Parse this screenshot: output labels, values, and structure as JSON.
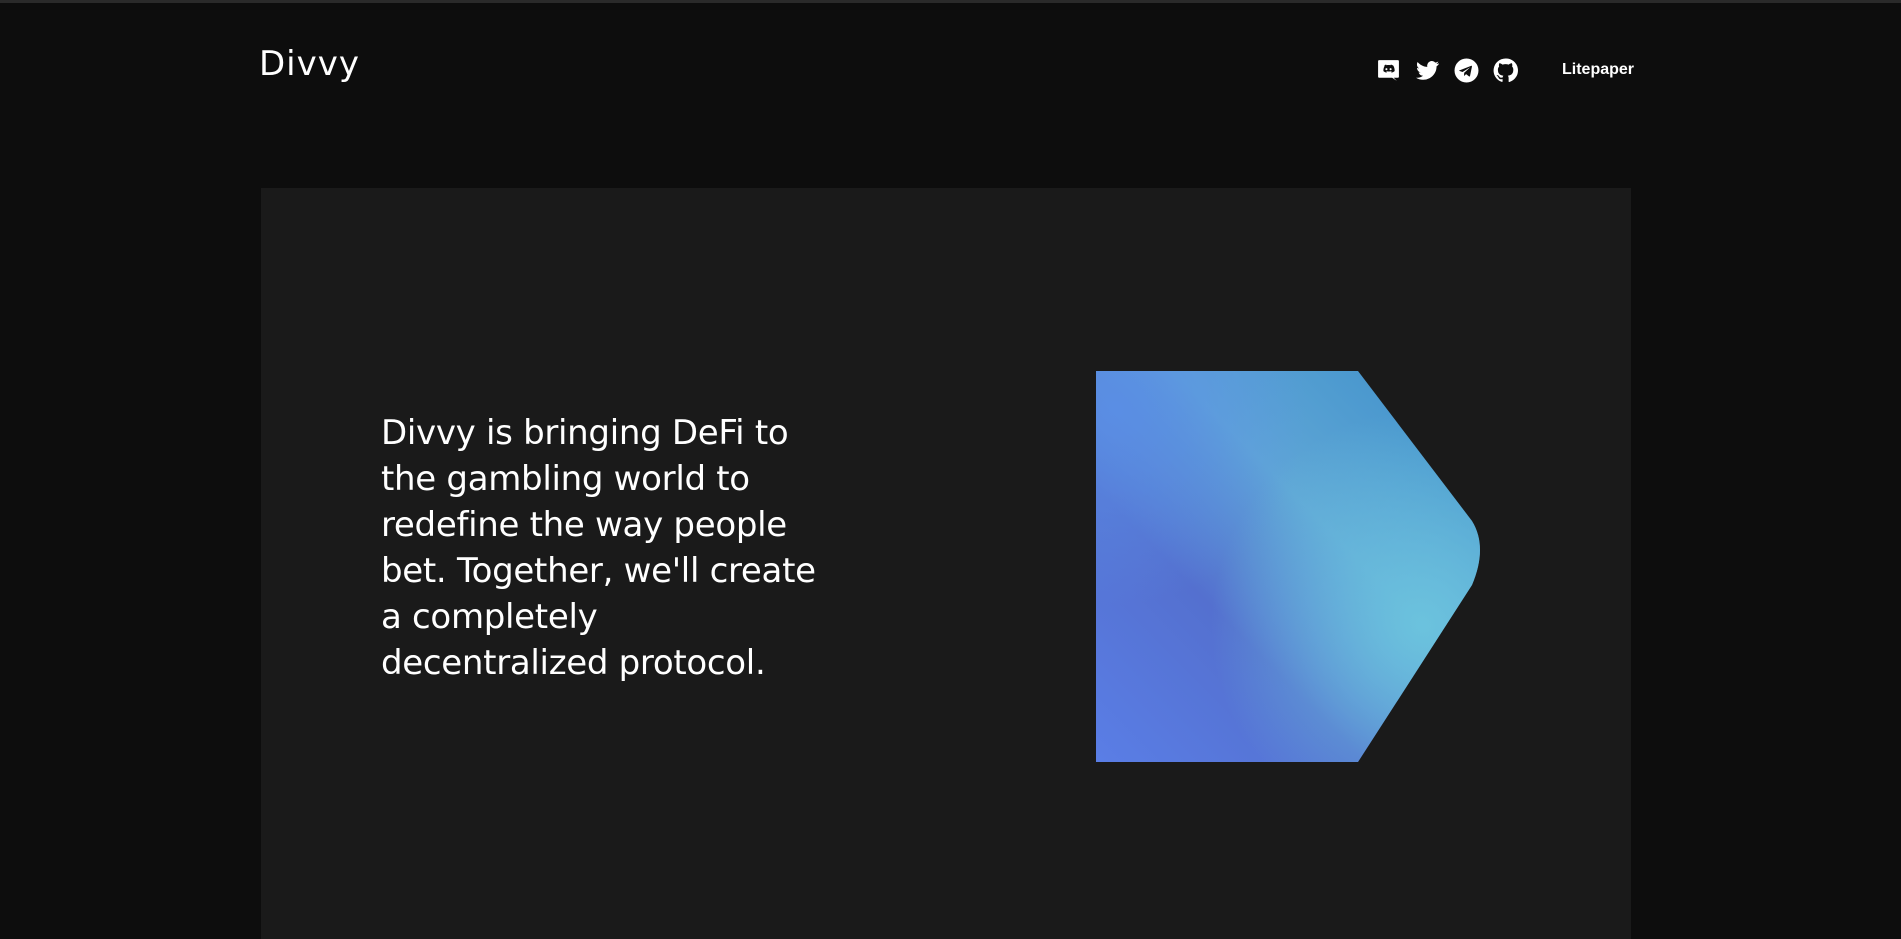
{
  "header": {
    "logo_text": "Divvy",
    "socials": [
      {
        "icon": "discord-icon"
      },
      {
        "icon": "twitter-icon"
      },
      {
        "icon": "telegram-icon"
      },
      {
        "icon": "github-icon"
      }
    ],
    "litepaper_label": "Litepaper"
  },
  "hero": {
    "tagline": "Divvy is bringing DeFi to the gambling world to redefine the way people bet. Together, we'll create a completely decentralized protocol.",
    "graphic": "divvy-d-shape",
    "gradient_colors": [
      "#5a7ee6",
      "#3d8fc9",
      "#5470cf",
      "#6cc4de"
    ]
  },
  "colors": {
    "page_background": "#0d0d0d",
    "hero_background": "#1a1a1a",
    "text": "#ffffff"
  }
}
